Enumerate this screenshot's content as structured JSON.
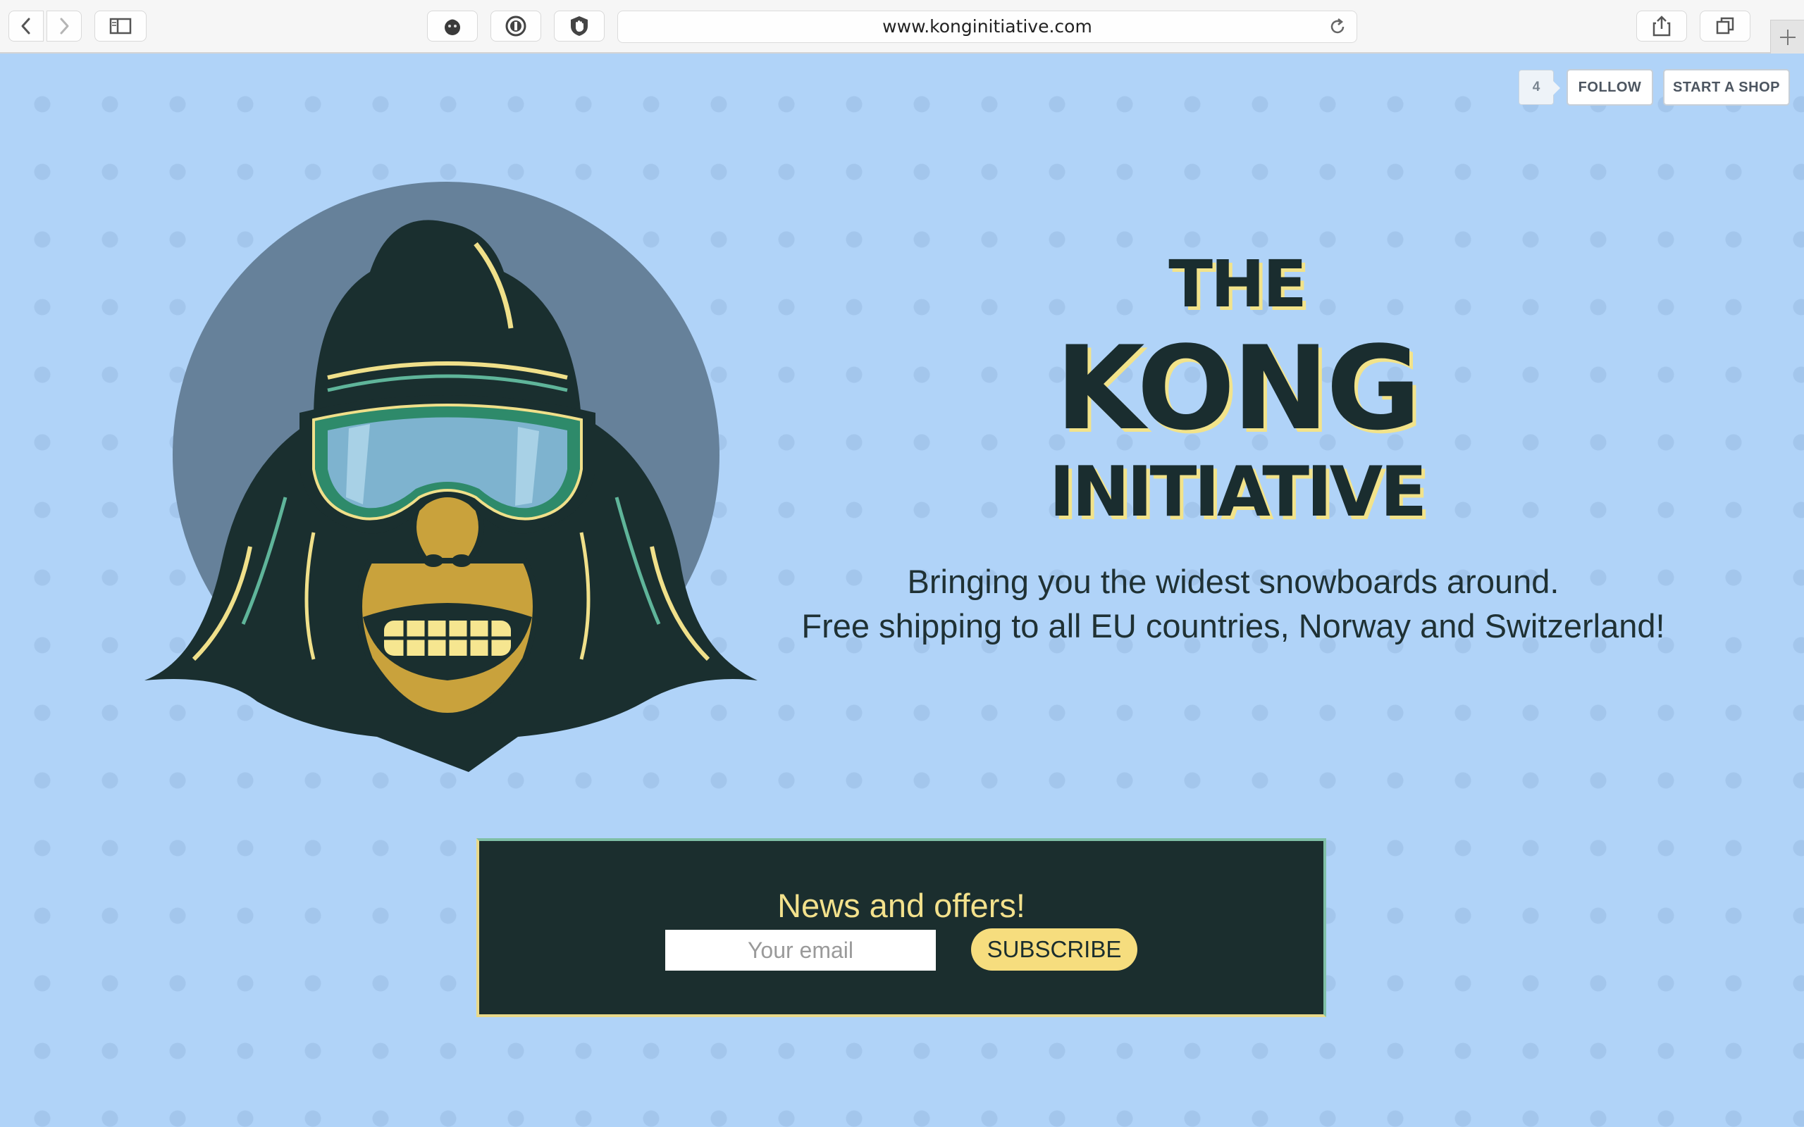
{
  "browser": {
    "url": "www.konginitiative.com",
    "icons": [
      "back-arrow-icon",
      "forward-arrow-icon",
      "sidebar-icon",
      "extension-icon",
      "password-icon",
      "adblock-icon",
      "reload-icon",
      "share-icon",
      "tabs-icon",
      "new-tab-icon"
    ]
  },
  "topbar": {
    "follow_count": "4",
    "follow_label": "FOLLOW",
    "start_shop_label": "START A SHOP"
  },
  "hero": {
    "title_line1": "THE",
    "title_line2": "KONG",
    "title_line3": "INITIATIVE",
    "tagline_line1": "Bringing you the widest snowboards around.",
    "tagline_line2": "Free shipping to all EU countries, Norway and Switzerland!"
  },
  "newsletter": {
    "heading": "News and offers!",
    "email_placeholder": "Your email",
    "email_value": "",
    "subscribe_label": "SUBSCRIBE"
  },
  "colors": {
    "page_bg": "#b0d3f8",
    "dark": "#1b2e2e",
    "accent_yellow": "#f6dd7e",
    "circle": "#66819a"
  }
}
